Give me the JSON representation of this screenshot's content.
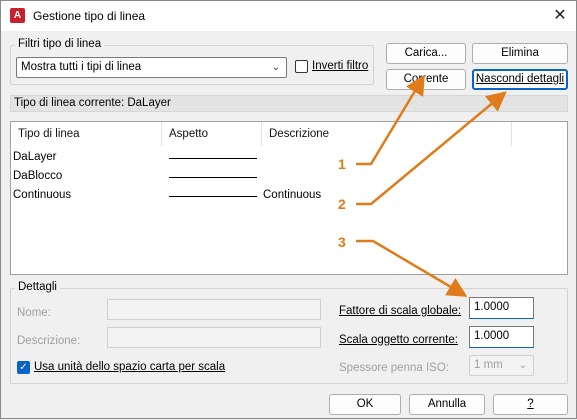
{
  "window": {
    "title": "Gestione tipo di linea",
    "close_glyph": "✕",
    "app_icon_letter": "A"
  },
  "filters": {
    "group_label": "Filtri tipo di linea",
    "selected": "Mostra tutti i tipi di linea",
    "invert_label": "Inverti filtro",
    "invert_checked": false
  },
  "buttons": {
    "load": "Carica...",
    "delete": "Elimina",
    "current": "Corrente",
    "hide_details": "Nascondi dettagli",
    "ok": "OK",
    "cancel": "Annulla",
    "help": "?"
  },
  "current_linetype": "Tipo di linea corrente:  DaLayer",
  "table": {
    "headers": [
      "Tipo di linea",
      "Aspetto",
      "Descrizione"
    ],
    "rows": [
      {
        "name": "DaLayer",
        "description": ""
      },
      {
        "name": "DaBlocco",
        "description": ""
      },
      {
        "name": "Continuous",
        "description": "Continuous"
      }
    ]
  },
  "details": {
    "group_label": "Dettagli",
    "name_label": "Nome:",
    "description_label": "Descrizione:",
    "paper_space_label": "Usa unità dello spazio carta per scala",
    "paper_space_checked": true,
    "global_scale_label": "Fattore di scala globale:",
    "global_scale_value": "1.0000",
    "object_scale_label": "Scala oggetto corrente:",
    "object_scale_value": "1.0000",
    "iso_pen_label": "Spessore penna ISO:",
    "iso_pen_value": "1 mm"
  },
  "callouts": [
    "1",
    "2",
    "3"
  ],
  "colors": {
    "accent": "#0a64c8",
    "arrow": "#e07b1a",
    "app_icon": "#c8202f"
  },
  "icons": {
    "close": "close-icon",
    "dropdown": "chevron-down-icon",
    "check": "checkmark-icon"
  }
}
